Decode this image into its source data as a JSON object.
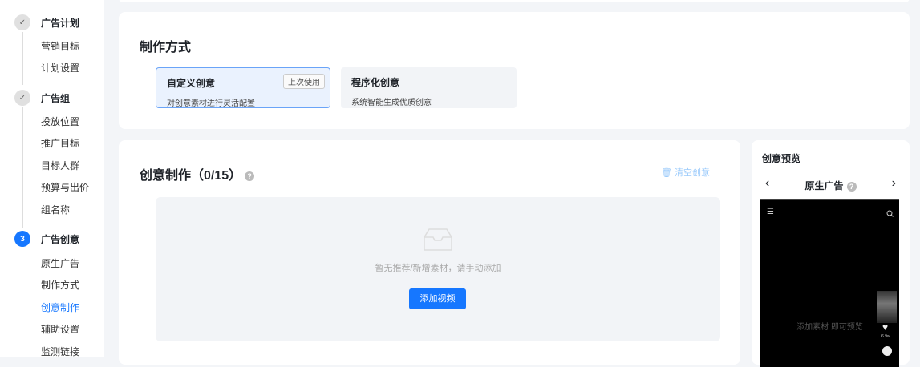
{
  "sidebar": {
    "steps": [
      {
        "label": "广告计划",
        "marker": "✓",
        "items": [
          "营销目标",
          "计划设置"
        ]
      },
      {
        "label": "广告组",
        "marker": "✓",
        "items": [
          "投放位置",
          "推广目标",
          "目标人群",
          "预算与出价",
          "组名称"
        ]
      },
      {
        "label": "广告创意",
        "marker": "3",
        "items": [
          "原生广告",
          "制作方式",
          "创意制作",
          "辅助设置",
          "监测链接"
        ]
      }
    ],
    "active_item": "创意制作"
  },
  "method": {
    "title": "制作方式",
    "options": [
      {
        "title": "自定义创意",
        "desc": "对创意素材进行灵活配置",
        "badge": "上次使用",
        "selected": true
      },
      {
        "title": "程序化创意",
        "desc": "系统智能生成优质创意",
        "selected": false
      }
    ]
  },
  "creative": {
    "title": "创意制作（0/15）",
    "help": "?",
    "clear_label": "清空创意",
    "empty_text": "暂无推荐/新增素材，请手动添加",
    "add_button": "添加视频"
  },
  "preview": {
    "title": "创意预览",
    "ad_type": "原生广告",
    "help": "?",
    "placeholder": "添加素材 即可预览",
    "like_count": "6.9w"
  },
  "colors": {
    "accent": "#1677ff"
  }
}
